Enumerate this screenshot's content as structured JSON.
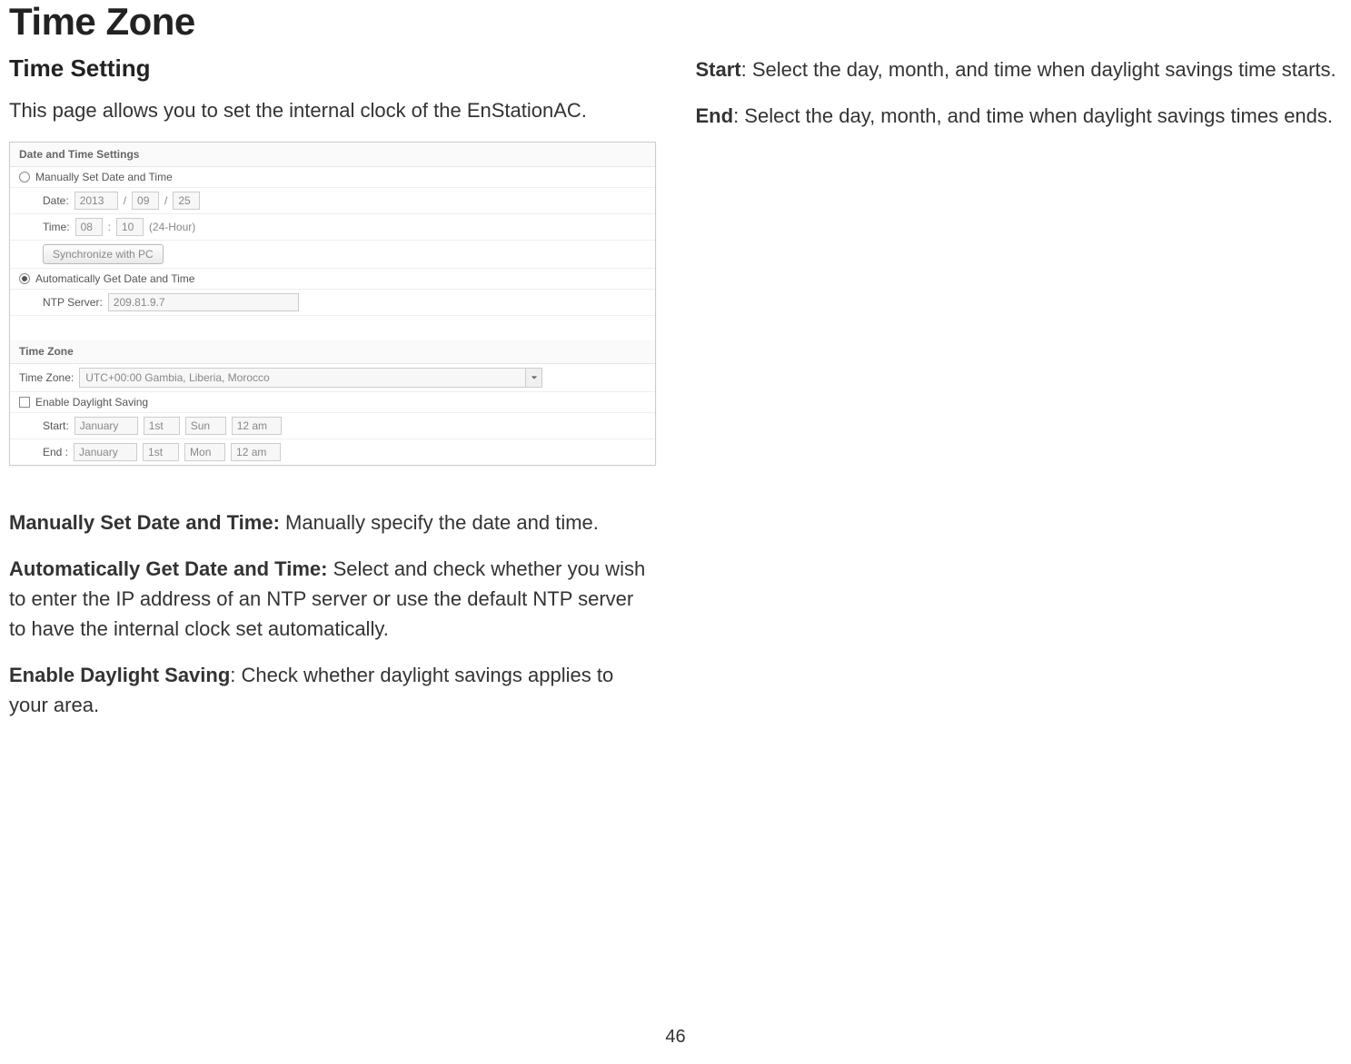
{
  "title": "Time Zone",
  "left": {
    "heading": "Time Setting",
    "intro": "This page allows you to set the internal clock of the EnStationAC.",
    "panel": {
      "sectionA": "Date and Time Settings",
      "manualRadio": "Manually Set Date and Time",
      "dateLabel": "Date:",
      "dateYear": "2013",
      "dateMonth": "09",
      "dateDay": "25",
      "dateSep": "/",
      "timeLabel": "Time:",
      "timeHour": "08",
      "timeSep": ":",
      "timeMin": "10",
      "timeFormat": "(24-Hour)",
      "syncBtn": "Synchronize with PC",
      "autoRadio": "Automatically Get Date and Time",
      "ntpLabel": "NTP Server:",
      "ntpValue": "209.81.9.7",
      "sectionB": "Time Zone",
      "tzLabel": "Time Zone:",
      "tzValue": "UTC+00:00 Gambia, Liberia, Morocco",
      "dstCheck": "Enable Daylight Saving",
      "startLabel": "Start:",
      "startMonth": "January",
      "startWeek": "1st",
      "startDay": "Sun",
      "startTime": "12 am",
      "endLabel": "End :",
      "endMonth": "January",
      "endWeek": "1st",
      "endDay": "Mon",
      "endTime": "12 am"
    },
    "p1_bold": "Manually Set Date and Time:",
    "p1_rest": " Manually specify the date and time.",
    "p2_bold": "Automatically Get Date and Time:",
    "p2_rest": " Select and check whether you wish to enter the IP address of an NTP server or use the default NTP server to have the internal clock set automatically.",
    "p3_bold": "Enable Daylight Saving",
    "p3_rest": ": Check whether daylight savings applies to your area."
  },
  "right": {
    "p1_bold": "Start",
    "p1_rest": ": Select the day, month, and time when daylight savings time starts.",
    "p2_bold": "End",
    "p2_rest": ": Select the day, month, and time when daylight savings times ends."
  },
  "pageNumber": "46"
}
